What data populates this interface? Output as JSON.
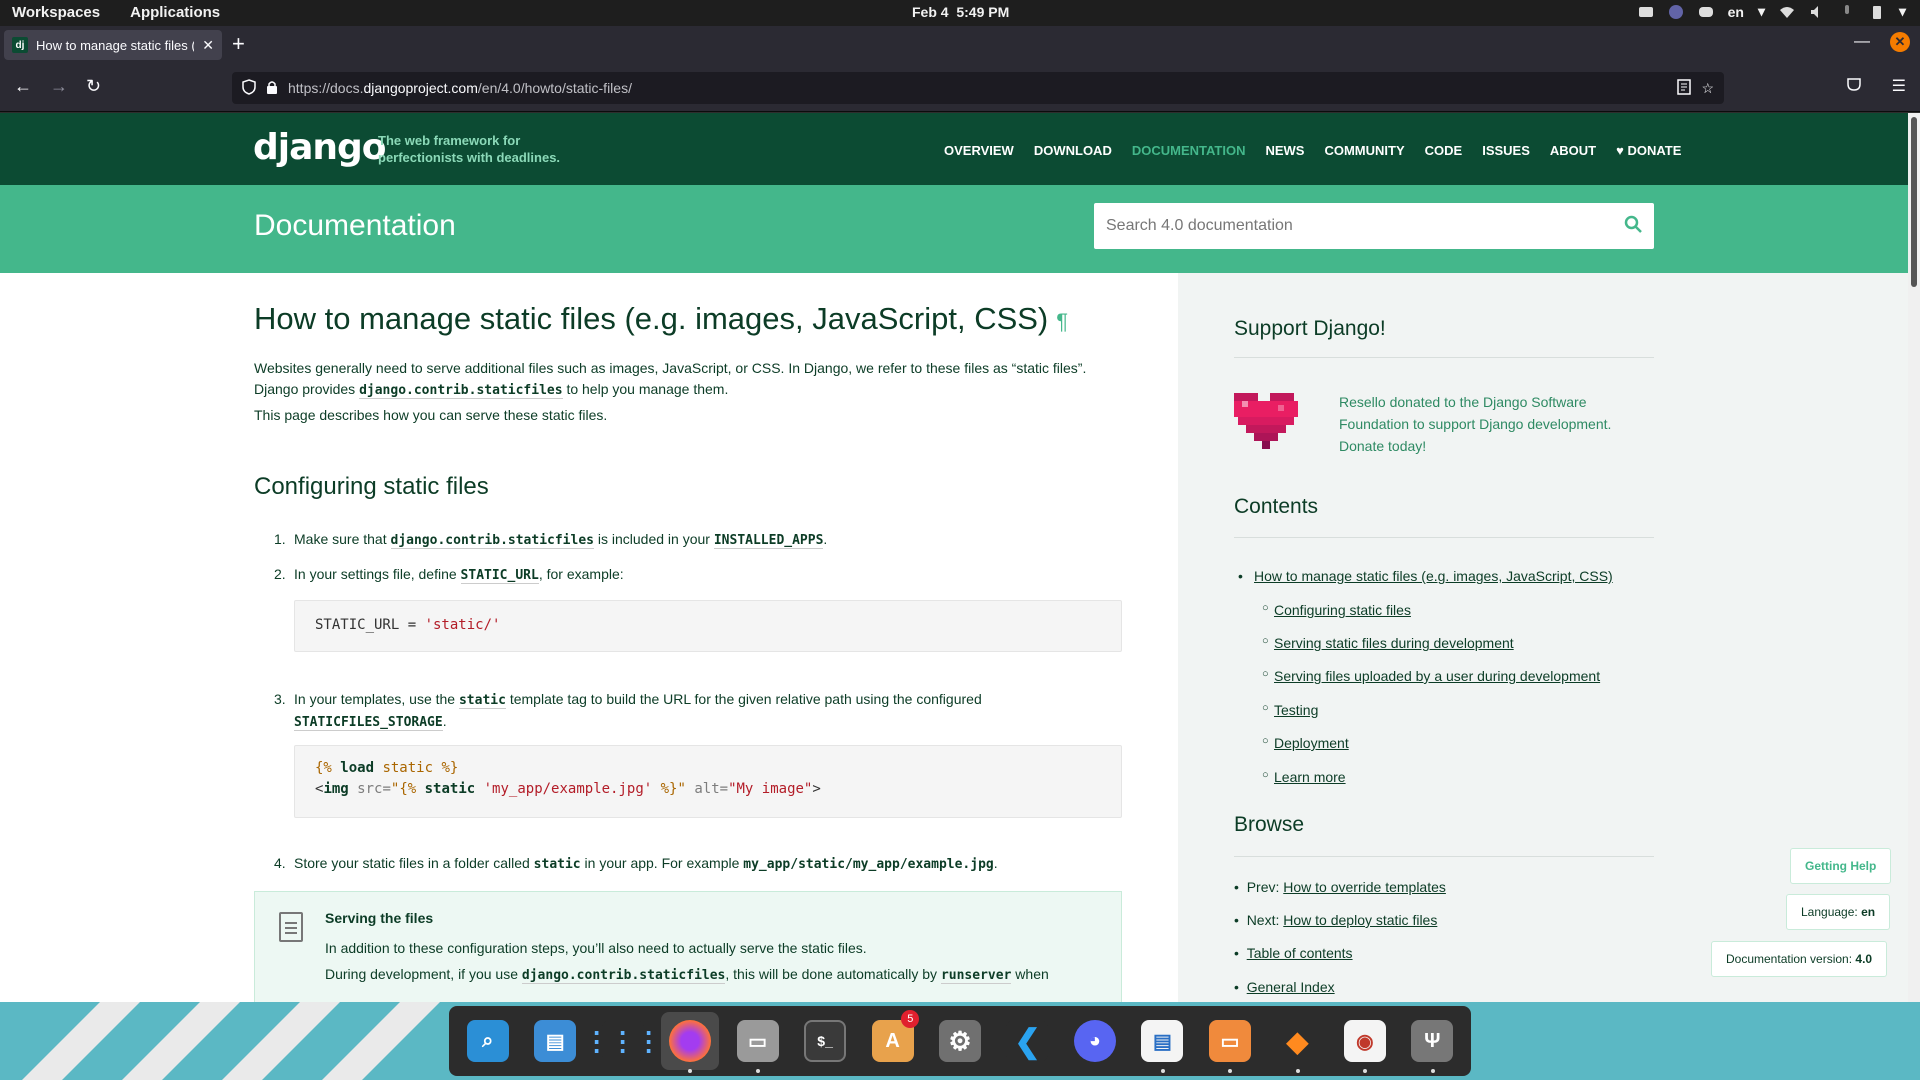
{
  "system": {
    "menu": [
      "Workspaces",
      "Applications"
    ],
    "date": "Feb 4",
    "time": "5:49 PM",
    "lang": "en"
  },
  "browser": {
    "tab_title": "How to manage static files (e",
    "tab_favicon": "dj",
    "url_prefix": "https://docs.",
    "url_domain": "djangoproject.com",
    "url_path": "/en/4.0/howto/static-files/"
  },
  "django": {
    "logo": "django",
    "tagline": "The web framework for perfectionists with deadlines.",
    "menu": [
      "OVERVIEW",
      "DOWNLOAD",
      "DOCUMENTATION",
      "NEWS",
      "COMMUNITY",
      "CODE",
      "ISSUES",
      "ABOUT",
      "♥ DONATE"
    ],
    "section_title": "Documentation",
    "search_placeholder": "Search 4.0 documentation"
  },
  "article": {
    "title": "How to manage static files (e.g. images, JavaScript, CSS)",
    "pilcrow": "¶",
    "intro_1": "Websites generally need to serve additional files such as images, JavaScript, or CSS. In Django, we refer to these files as “static files”.",
    "intro_2a": "Django provides ",
    "intro_2_code": "django.contrib.staticfiles",
    "intro_2b": " to help you manage them.",
    "intro_3": "This page describes how you can serve these static files.",
    "section": "Configuring static files",
    "step1a": "Make sure that ",
    "step1_code": "django.contrib.staticfiles",
    "step1b": " is included in your ",
    "step1_code2": "INSTALLED_APPS",
    "step1c": ".",
    "step2a": "In your settings file, define ",
    "step2_code": "STATIC_URL",
    "step2b": ", for example:",
    "code1_a": "STATIC_URL = ",
    "code1_str": "'static/'",
    "step3a": "In your templates, use the ",
    "step3_code": "static",
    "step3b": " template tag to build the URL for the given relative path using the configured",
    "step3_code2": "STATICFILES_STORAGE",
    "step3c": ".",
    "code2_l1_open": "{% ",
    "code2_l1_kw": "load",
    "code2_l1_rest": " static ",
    "code2_l1_close": "%}",
    "code2_l2_lt": "<",
    "code2_l2_tag": "img",
    "code2_l2_attr": " src=",
    "code2_l2_q1": "\"{% ",
    "code2_l2_kw": "static",
    "code2_l2_path": " 'my_app/example.jpg' ",
    "code2_l2_q2": "%}\"",
    "code2_l2_attr2": " alt=",
    "code2_l2_alt": "\"My image\"",
    "code2_l2_gt": ">",
    "step4a": "Store your static files in a folder called ",
    "step4_code": "static",
    "step4b": " in your app. For example ",
    "step4_code2": "my_app/static/my_app/example.jpg",
    "step4c": ".",
    "note_title": "Serving the files",
    "note_1": "In addition to these configuration steps, you’ll also need to actually serve the static files.",
    "note_2a": "During development, if you use ",
    "note_2_code": "django.contrib.staticfiles",
    "note_2b": ", this will be done automatically by ",
    "note_2_code2": "runserver",
    "note_2c": " when"
  },
  "sidebar": {
    "support_title": "Support Django!",
    "support_text": "Resello donated to the Django Software Foundation to support Django development. Donate today!",
    "contents_title": "Contents",
    "contents_main": "How to manage static files (e.g. images, JavaScript, CSS)",
    "contents_sub": [
      "Configuring static files",
      "Serving static files during development",
      "Serving files uploaded by a user during development",
      "Testing",
      "Deployment",
      "Learn more"
    ],
    "browse_title": "Browse",
    "browse": [
      {
        "prefix": "Prev: ",
        "link": "How to override templates"
      },
      {
        "prefix": "Next: ",
        "link": "How to deploy static files"
      },
      {
        "prefix": "",
        "link": "Table of contents"
      },
      {
        "prefix": "",
        "link": "General Index"
      }
    ]
  },
  "floating": {
    "help": "Getting Help",
    "language_label": "Language: ",
    "language_value": "en",
    "version_label": "Documentation version: ",
    "version_value": "4.0"
  },
  "dock": {
    "items": [
      "search-app",
      "file-manager",
      "app-grid",
      "firefox",
      "files",
      "terminal",
      "software-center",
      "settings",
      "vscode",
      "discord",
      "document-viewer",
      "presentation",
      "fl-studio",
      "document-reader",
      "usb-tool"
    ],
    "badge": "5"
  }
}
